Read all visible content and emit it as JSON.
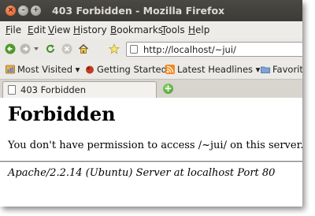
{
  "window": {
    "title": "403 Forbidden - Mozilla Firefox",
    "close_glyph": "×",
    "minimize_glyph": "–",
    "maximize_glyph": "+"
  },
  "menubar": {
    "items": [
      {
        "label": "File",
        "accel": "F",
        "rest": "ile"
      },
      {
        "label": "Edit",
        "accel": "E",
        "rest": "dit"
      },
      {
        "label": "View",
        "accel": "V",
        "rest": "iew"
      },
      {
        "label": "History",
        "accel": "H",
        "rest": "istory"
      },
      {
        "label": "Bookmarks",
        "accel": "B",
        "rest": "ookmarks"
      },
      {
        "label": "Tools",
        "accel": "T",
        "rest": "ools"
      },
      {
        "label": "Help",
        "accel": "H",
        "rest": "elp"
      }
    ]
  },
  "navbar": {
    "icons": [
      "back-icon",
      "forward-icon",
      "dropdown-icon",
      "reload-icon",
      "stop-icon",
      "home-icon",
      "bookmark-star-icon"
    ],
    "url": "http://localhost/~jui/"
  },
  "bookmarks": {
    "items": [
      {
        "label": "Most Visited ▾",
        "icon": "most-visited-icon"
      },
      {
        "label": "Getting Started",
        "icon": "getting-started-icon"
      },
      {
        "label": "Latest Headlines ▾",
        "icon": "rss-feed-icon"
      },
      {
        "label": "Favorit",
        "icon": "folder-icon"
      }
    ]
  },
  "tabs": {
    "items": [
      {
        "label": "403 Forbidden"
      }
    ],
    "new_tab_glyph": "+"
  },
  "page": {
    "heading": "Forbidden",
    "message": "You don't have permission to access /~jui/ on this server.",
    "address": "Apache/2.2.14 (Ubuntu) Server at localhost Port 80"
  },
  "colors": {
    "titlebar": "#3c3b37",
    "toolbar": "#ebe9e5",
    "close_button": "#e0521f",
    "new_tab_button": "#3f9a24"
  }
}
